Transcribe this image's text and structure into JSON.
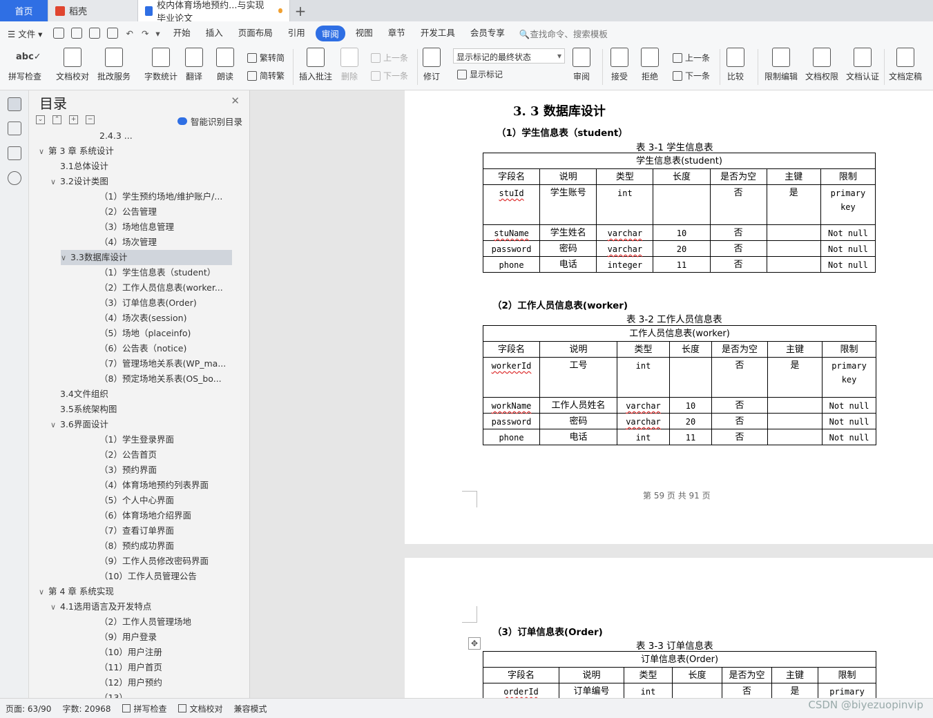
{
  "tabs": {
    "home": "首页",
    "daoke": "稻壳",
    "doc": "校内体育场地预约...与实现 毕业论文",
    "new_tab": "+"
  },
  "menu": {
    "file": "文件",
    "items": [
      "开始",
      "插入",
      "页面布局",
      "引用",
      "审阅",
      "视图",
      "章节",
      "开发工具",
      "会员专享"
    ],
    "active": "审阅",
    "search": "查找命令、搜索模板"
  },
  "ribbon": {
    "spell": "拼写检查",
    "proof": "文档校对",
    "revise_service": "批改服务",
    "word_count": "字数统计",
    "translate": "翻译",
    "read_aloud": "朗读",
    "trad_to_simp": "繁转简",
    "simp_to_trad": "简转繁",
    "insert_comment": "插入批注",
    "delete": "删除",
    "prev_comment": "上一条",
    "next_comment": "下一条",
    "revise": "修订",
    "mark_state": "显示标记的最终状态",
    "show_marks": "显示标记",
    "review": "审阅",
    "accept": "接受",
    "reject": "拒绝",
    "prev": "上一条",
    "next": "下一条",
    "compare": "比较",
    "restrict_edit": "限制编辑",
    "doc_rights": "文档权限",
    "doc_cert": "文档认证",
    "doc_final": "文档定稿"
  },
  "toc": {
    "title": "目录",
    "smart": "智能识别目录",
    "items": [
      {
        "label": "2.4.3 ...",
        "level": 2,
        "exp": ""
      },
      {
        "label": "第 3 章 系统设计",
        "level": 0,
        "exp": "v"
      },
      {
        "label": "3.1总体设计",
        "level": 1,
        "exp": ""
      },
      {
        "label": "3.2设计类图",
        "level": 1,
        "exp": "v"
      },
      {
        "label": "（1）学生预约场地/维护账户/...",
        "level": 2,
        "exp": ""
      },
      {
        "label": "（2）公告管理",
        "level": 2,
        "exp": ""
      },
      {
        "label": "（3）场地信息管理",
        "level": 2,
        "exp": ""
      },
      {
        "label": "（4）场次管理",
        "level": 2,
        "exp": ""
      },
      {
        "label": "3.3数据库设计",
        "level": 1,
        "exp": "v",
        "sel": true
      },
      {
        "label": "（1）学生信息表（student）",
        "level": 2,
        "exp": ""
      },
      {
        "label": "（2）工作人员信息表(worker...",
        "level": 2,
        "exp": ""
      },
      {
        "label": "（3）订单信息表(Order)",
        "level": 2,
        "exp": ""
      },
      {
        "label": "（4）场次表(session)",
        "level": 2,
        "exp": ""
      },
      {
        "label": "（5）场地（placeinfo)",
        "level": 2,
        "exp": ""
      },
      {
        "label": "（6）公告表（notice)",
        "level": 2,
        "exp": ""
      },
      {
        "label": "（7）管理场地关系表(WP_ma...",
        "level": 2,
        "exp": ""
      },
      {
        "label": "（8）预定场地关系表(OS_bo...",
        "level": 2,
        "exp": ""
      },
      {
        "label": "3.4文件组织",
        "level": 1,
        "exp": ""
      },
      {
        "label": "3.5系统架构图",
        "level": 1,
        "exp": ""
      },
      {
        "label": "3.6界面设计",
        "level": 1,
        "exp": "v"
      },
      {
        "label": "（1）学生登录界面",
        "level": 2,
        "exp": ""
      },
      {
        "label": "（2）公告首页",
        "level": 2,
        "exp": ""
      },
      {
        "label": "（3）预约界面",
        "level": 2,
        "exp": ""
      },
      {
        "label": "（4）体育场地预约列表界面",
        "level": 2,
        "exp": ""
      },
      {
        "label": "（5）个人中心界面",
        "level": 2,
        "exp": ""
      },
      {
        "label": "（6）体育场地介绍界面",
        "level": 2,
        "exp": ""
      },
      {
        "label": "（7）查看订单界面",
        "level": 2,
        "exp": ""
      },
      {
        "label": "（8）预约成功界面",
        "level": 2,
        "exp": ""
      },
      {
        "label": "（9）工作人员修改密码界面",
        "level": 2,
        "exp": ""
      },
      {
        "label": "（10）工作人员管理公告",
        "level": 2,
        "exp": ""
      },
      {
        "label": "第 4 章 系统实现",
        "level": 0,
        "exp": "v"
      },
      {
        "label": "4.1选用语言及开发特点",
        "level": 1,
        "exp": "v"
      },
      {
        "label": "（2）工作人员管理场地",
        "level": 2,
        "exp": ""
      },
      {
        "label": "（9）用户登录",
        "level": 2,
        "exp": ""
      },
      {
        "label": "（10）用户注册",
        "level": 2,
        "exp": ""
      },
      {
        "label": "（11）用户首页",
        "level": 2,
        "exp": ""
      },
      {
        "label": "（12）用户预约",
        "level": 2,
        "exp": ""
      },
      {
        "label": "（13）...",
        "level": 2,
        "exp": ""
      }
    ]
  },
  "doc": {
    "section_heading": "3. 3 数据库设计",
    "t1_sub": "（1）学生信息表（student）",
    "t1_cap": "表 3-1   学生信息表",
    "t1_title": "学生信息表(student)",
    "headers": [
      "字段名",
      "说明",
      "类型",
      "长度",
      "是否为空",
      "主键",
      "限制"
    ],
    "t1_rows": [
      [
        "stuId",
        "学生账号",
        "int",
        "",
        "否",
        "是",
        "primary key"
      ],
      [
        "stuName",
        "学生姓名",
        "varchar",
        "10",
        "否",
        "",
        "Not null"
      ],
      [
        "password",
        "密码",
        "varchar",
        "20",
        "否",
        "",
        "Not null"
      ],
      [
        "phone",
        "电话",
        "integer",
        "11",
        "否",
        "",
        "Not null"
      ]
    ],
    "t2_sub": "（2）工作人员信息表(worker)",
    "t2_cap": "表 3-2   工作人员信息表",
    "t2_title": "工作人员信息表(worker)",
    "t2_rows": [
      [
        "workerId",
        "工号",
        "int",
        "",
        "否",
        "是",
        "primary key"
      ],
      [
        "workName",
        "工作人员姓名",
        "varchar",
        "10",
        "否",
        "",
        "Not null"
      ],
      [
        "password",
        "密码",
        "varchar",
        "20",
        "否",
        "",
        "Not null"
      ],
      [
        "phone",
        "电话",
        "int",
        "11",
        "否",
        "",
        "Not null"
      ]
    ],
    "page_number": "第 59 页 共 91 页",
    "t3_sub": "（3）订单信息表(Order)",
    "t3_cap": "表 3-3   订单信息表",
    "t3_title": "订单信息表(Order)",
    "t3_rows": [
      [
        "orderId",
        "订单编号",
        "int",
        "",
        "否",
        "是",
        "primary"
      ]
    ]
  },
  "status": {
    "page": "页面: 63/90",
    "words": "字数: 20968",
    "spell": "拼写检查",
    "proof": "文档校对",
    "compat": "兼容模式"
  },
  "watermark": "CSDN @biyezuopinvip",
  "colors": {
    "accent": "#2f6fe4",
    "toc_selected": "#d0d5dc"
  }
}
